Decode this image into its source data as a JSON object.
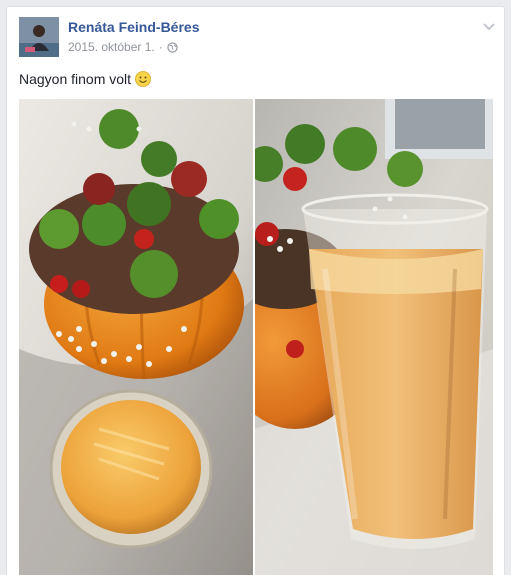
{
  "post": {
    "author": "Renáta Feind-Béres",
    "date": "2015. október 1.",
    "separator": "·",
    "text": "Nagyon finom volt"
  },
  "icons": {
    "privacy": "globe-icon",
    "menu": "chevron-down-icon",
    "emoji": "smiley-emoji-icon"
  },
  "colors": {
    "author_link": "#365899",
    "meta_text": "#90949c",
    "body_text": "#1d2129",
    "page_background": "#e9ebee"
  }
}
